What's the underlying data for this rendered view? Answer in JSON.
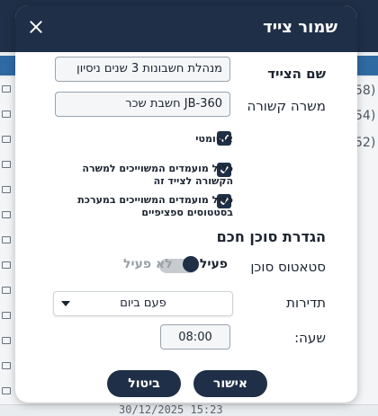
{
  "background": {
    "right_numbers": [
      "58)",
      "54)",
      "52)"
    ],
    "bottom_text": "30/12/2025 15:23"
  },
  "modal": {
    "title": "שמור צייד",
    "close_icon": "close-icon",
    "fields": {
      "name_label": "שם הצייד",
      "name_value": "מנהלת חשבונות 3 שנים ניסיון",
      "job_label": "משרה קשורה",
      "job_value": "JB-360 חשבת שכר"
    },
    "checkboxes": [
      {
        "label": "אוטומטי",
        "checked": true
      },
      {
        "label": "כלול מועמדים המשוייכים למשרה הקשורה לצייד זה",
        "checked": true
      },
      {
        "label": "כלול מועמדים המשוייכים במערכת בסטטוסים ספציפיים",
        "checked": true
      }
    ],
    "smart_agent": {
      "section_title": "הגדרת סוכן חכם",
      "status_label": "סטאטוס סוכן",
      "toggle_on": "פעיל",
      "toggle_off": "לא פעיל",
      "frequency_label": "תדירות",
      "frequency_value": "פעם ביום",
      "time_label": "שעה:",
      "time_value": "08:00"
    },
    "buttons": {
      "confirm": "אישור",
      "cancel": "ביטול"
    }
  }
}
